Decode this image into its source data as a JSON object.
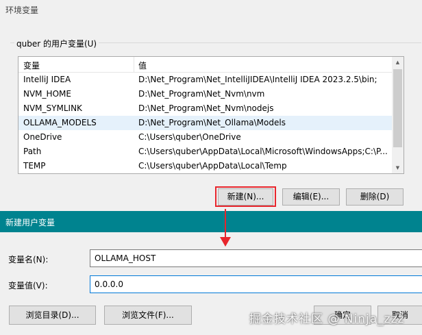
{
  "env_window": {
    "title": "环境变量",
    "group_label": "quber 的用户变量(U)",
    "columns": {
      "name": "变量",
      "value": "值"
    },
    "rows": [
      {
        "name": "IntelliJ IDEA",
        "value": "D:\\Net_Program\\Net_IntelliJIDEA\\IntelliJ IDEA 2023.2.5\\bin;"
      },
      {
        "name": "NVM_HOME",
        "value": "D:\\Net_Program\\Net_Nvm\\nvm"
      },
      {
        "name": "NVM_SYMLINK",
        "value": "D:\\Net_Program\\Net_Nvm\\nodejs"
      },
      {
        "name": "OLLAMA_MODELS",
        "value": "D:\\Net_Program\\Net_Ollama\\Models"
      },
      {
        "name": "OneDrive",
        "value": "C:\\Users\\quber\\OneDrive"
      },
      {
        "name": "Path",
        "value": "C:\\Users\\quber\\AppData\\Local\\Microsoft\\WindowsApps;C:\\P..."
      },
      {
        "name": "TEMP",
        "value": "C:\\Users\\quber\\AppData\\Local\\Temp"
      }
    ],
    "selected_row": 3,
    "buttons": {
      "new": "新建(N)...",
      "edit": "编辑(E)...",
      "delete": "删除(D)"
    }
  },
  "new_var_dialog": {
    "title": "新建用户变量",
    "name_label": "变量名(N):",
    "name_value": "OLLAMA_HOST",
    "value_label": "变量值(V):",
    "value_value": "0.0.0.0",
    "buttons": {
      "browse_dir": "浏览目录(D)...",
      "browse_file": "浏览文件(F)...",
      "ok": "确定",
      "cancel": "取消"
    }
  },
  "watermark": "掘金技术社区 @ Ninja_zzz",
  "colors": {
    "dialog_titlebar": "#00838f",
    "highlight": "#e8252c",
    "selection": "#e5f1fb",
    "input_focus": "#0078d7"
  },
  "icons": {
    "scroll_up": "▲",
    "scroll_down": "▼"
  }
}
